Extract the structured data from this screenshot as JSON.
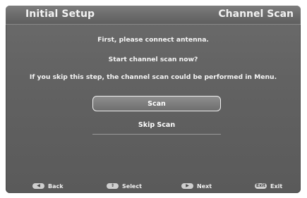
{
  "header": {
    "title": "Initial Setup",
    "section": "Channel Scan"
  },
  "messages": {
    "line1": "First, please connect antenna.",
    "line2": "Start channel scan now?",
    "line3": "If you skip this step, the channel scan could be performed in Menu."
  },
  "buttons": {
    "scan": "Scan",
    "skip": "Skip Scan"
  },
  "footer": [
    {
      "key_icon": "left-arrow-icon",
      "key_glyph": "◀",
      "label": "Back"
    },
    {
      "key_icon": "up-down-arrow-icon",
      "key_glyph": "⇕",
      "label": "Select"
    },
    {
      "key_icon": "right-arrow-icon",
      "key_glyph": "▶",
      "label": "Next"
    },
    {
      "key_icon": "exit-key-icon",
      "key_glyph": "Exit",
      "label": "Exit"
    }
  ],
  "colors": {
    "panel": "#626262",
    "text": "#f5f5f5",
    "focus_border": "#f0f0f0"
  }
}
